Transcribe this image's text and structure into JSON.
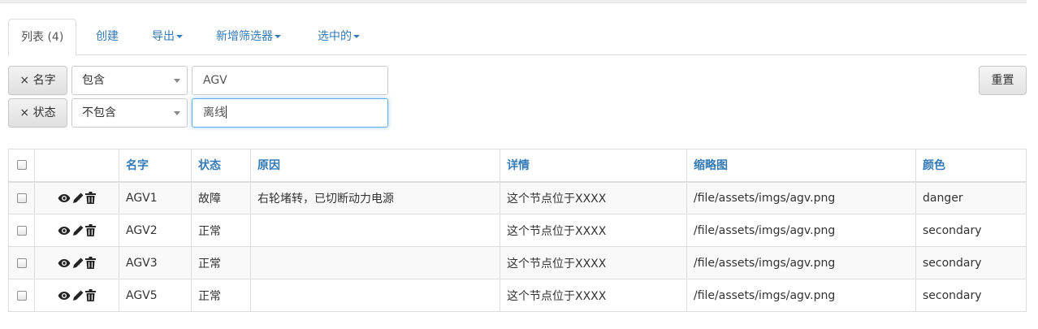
{
  "tabs": [
    {
      "label": "列表 (4)",
      "active": true
    },
    {
      "label": "创建"
    },
    {
      "label": "导出",
      "dropdown": true
    },
    {
      "label": "新增筛选器",
      "dropdown": true
    },
    {
      "label": "选中的",
      "dropdown": true
    }
  ],
  "filters": [
    {
      "remove_label": "× 名字",
      "operator": "包含",
      "value": "AGV"
    },
    {
      "remove_label": "× 状态",
      "operator": "不包含",
      "value": "离线"
    }
  ],
  "reset_label": "重置",
  "table": {
    "headers": [
      "名字",
      "状态",
      "原因",
      "详情",
      "缩略图",
      "颜色"
    ],
    "rows": [
      [
        "AGV1",
        "故障",
        "右轮堵转，已切断动力电源",
        "这个节点位于XXXX",
        "/file/assets/imgs/agv.png",
        "danger"
      ],
      [
        "AGV2",
        "正常",
        "",
        "这个节点位于XXXX",
        "/file/assets/imgs/agv.png",
        "secondary"
      ],
      [
        "AGV3",
        "正常",
        "",
        "这个节点位于XXXX",
        "/file/assets/imgs/agv.png",
        "secondary"
      ],
      [
        "AGV5",
        "正常",
        "",
        "这个节点位于XXXX",
        "/file/assets/imgs/agv.png",
        "secondary"
      ]
    ]
  },
  "icons": {
    "view": "eye-icon",
    "edit": "pencil-icon",
    "delete": "trash-icon"
  },
  "colors": {
    "link": "#337ab7",
    "focus": "#66afe9"
  }
}
